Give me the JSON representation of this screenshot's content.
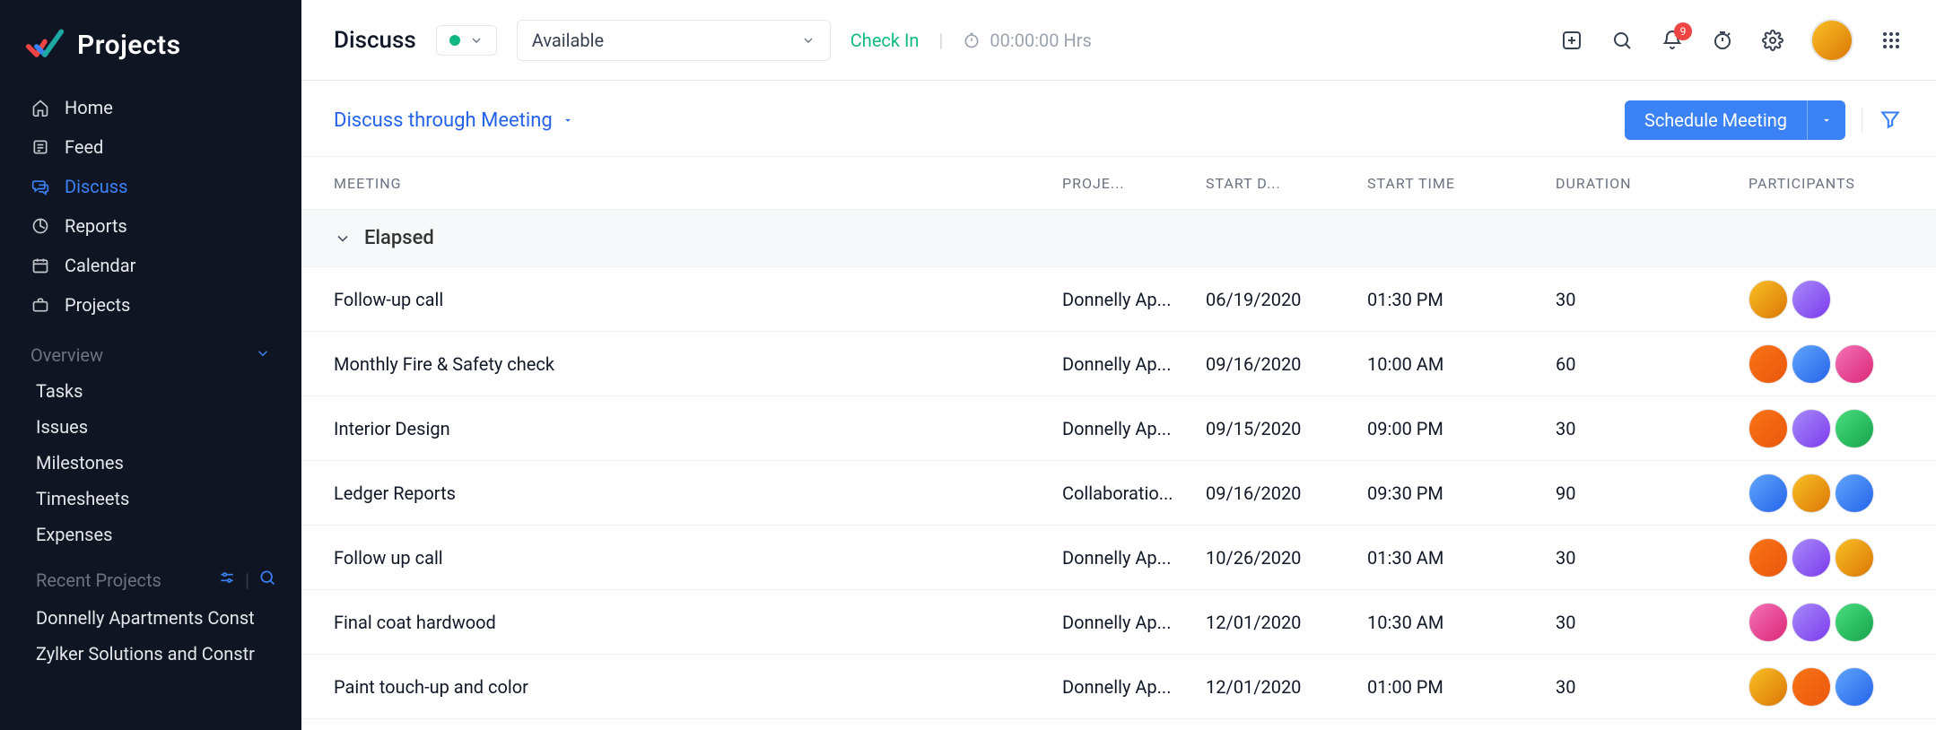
{
  "app": {
    "name": "Projects"
  },
  "sidebar": {
    "nav": [
      {
        "label": "Home"
      },
      {
        "label": "Feed"
      },
      {
        "label": "Discuss",
        "active": true
      },
      {
        "label": "Reports"
      },
      {
        "label": "Calendar"
      },
      {
        "label": "Projects"
      }
    ],
    "overview": {
      "title": "Overview",
      "items": [
        "Tasks",
        "Issues",
        "Milestones",
        "Timesheets",
        "Expenses"
      ]
    },
    "recent": {
      "title": "Recent Projects",
      "items": [
        "Donnelly Apartments Const",
        "Zylker Solutions and Constr"
      ]
    }
  },
  "topbar": {
    "title": "Discuss",
    "status_select": "Available",
    "checkin": "Check In",
    "timer": "00:00:00 Hrs",
    "notification_count": "9"
  },
  "subheader": {
    "view_label": "Discuss through Meeting",
    "schedule_label": "Schedule Meeting"
  },
  "table": {
    "columns": {
      "meeting": "MEETING",
      "project": "PROJE...",
      "start_date": "START D...",
      "start_time": "START TIME",
      "duration": "DURATION",
      "participants": "PARTICIPANTS"
    },
    "group_label": "Elapsed",
    "rows": [
      {
        "meeting": "Follow-up call",
        "project": "Donnelly Ap...",
        "start_date": "06/19/2020",
        "start_time": "01:30 PM",
        "duration": "30",
        "avatars": [
          "p5",
          "p3"
        ]
      },
      {
        "meeting": "Monthly Fire & Safety check",
        "project": "Donnelly Ap...",
        "start_date": "09/16/2020",
        "start_time": "10:00 AM",
        "duration": "60",
        "avatars": [
          "p1",
          "p2",
          "p6"
        ]
      },
      {
        "meeting": "Interior Design",
        "project": "Donnelly Ap...",
        "start_date": "09/15/2020",
        "start_time": "09:00 PM",
        "duration": "30",
        "avatars": [
          "p1",
          "p3",
          "p4"
        ]
      },
      {
        "meeting": "Ledger Reports",
        "project": "Collaboratio...",
        "start_date": "09/16/2020",
        "start_time": "09:30 PM",
        "duration": "90",
        "avatars": [
          "p2",
          "p5",
          "p2"
        ]
      },
      {
        "meeting": "Follow up call",
        "project": "Donnelly Ap...",
        "start_date": "10/26/2020",
        "start_time": "01:30 AM",
        "duration": "30",
        "avatars": [
          "p1",
          "p3",
          "p5"
        ]
      },
      {
        "meeting": "Final coat hardwood",
        "project": "Donnelly Ap...",
        "start_date": "12/01/2020",
        "start_time": "10:30 AM",
        "duration": "30",
        "avatars": [
          "p6",
          "p3",
          "p4"
        ]
      },
      {
        "meeting": "Paint touch-up and color",
        "project": "Donnelly Ap...",
        "start_date": "12/01/2020",
        "start_time": "01:00 PM",
        "duration": "30",
        "avatars": [
          "p5",
          "p1",
          "p2"
        ]
      }
    ]
  }
}
